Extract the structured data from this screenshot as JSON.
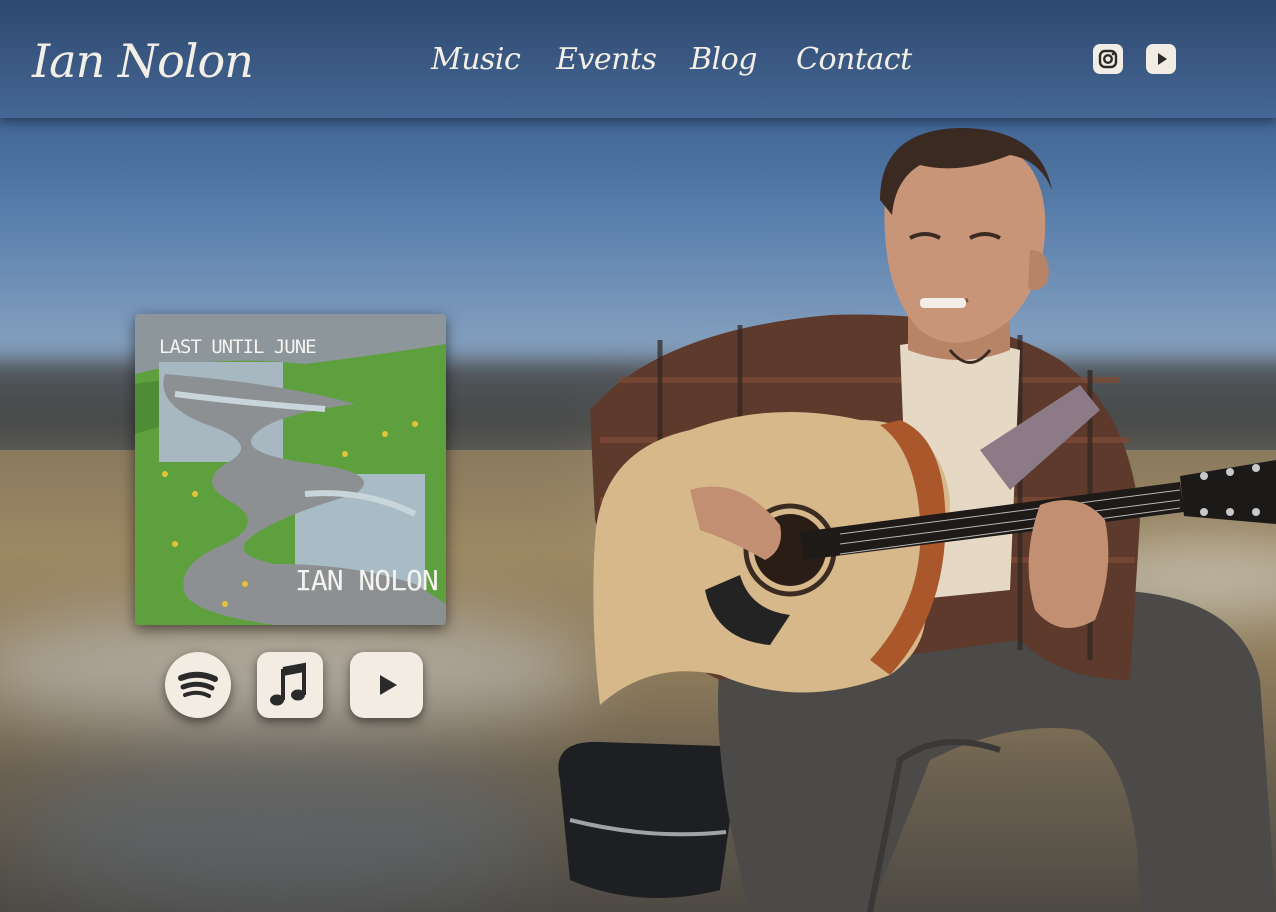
{
  "site": {
    "name": "Ian Nolon"
  },
  "nav": {
    "items": [
      {
        "label": "Music"
      },
      {
        "label": "Events"
      },
      {
        "label": "Blog"
      },
      {
        "label": "Contact"
      }
    ]
  },
  "social": {
    "icons": [
      "instagram-icon",
      "youtube-icon"
    ]
  },
  "album": {
    "title": "LAST UNTIL JUNE",
    "artist": "IAN NOLON",
    "cover_icon": "album-cover-painting"
  },
  "streaming": {
    "icons": [
      "spotify-icon",
      "apple-music-icon",
      "youtube-play-icon"
    ]
  },
  "colors": {
    "header": "#3e6190",
    "text_light": "#f3efe6",
    "button_bg": "#f2ece2",
    "icon_dark": "#2a2a2a"
  }
}
